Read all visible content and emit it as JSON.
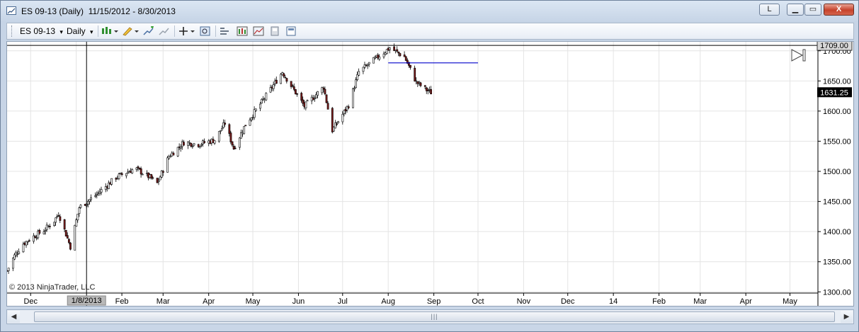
{
  "window": {
    "title": "ES 09-13 (Daily)  11/15/2012 - 8/30/2013",
    "buttons": {
      "link": "L",
      "minimize": "▁",
      "maximize": "▭",
      "close": "X"
    }
  },
  "toolbar": {
    "instrument": "ES 09-13",
    "interval": "Daily",
    "dropdown_glyph": "▾",
    "icons": [
      "candlestick-icon",
      "drawing-pencil-icon",
      "add-indicator-icon",
      "strategy-icon",
      "crosshair-icon",
      "zoom-icon",
      "properties-icon",
      "chart-style-icon",
      "trend-icon",
      "save-icon",
      "template-icon"
    ]
  },
  "chart": {
    "copyright": "© 2013 NinjaTrader, LLC",
    "crosshair_label": "1/8/2013",
    "crosshair_price_label": "1709.00",
    "last_price_label": "1631.25",
    "horizontal_line_price": 1680,
    "colors": {
      "up": "#000000",
      "down": "#7a1a1a",
      "line": "#0000cc"
    }
  },
  "chart_data": {
    "type": "candlestick",
    "xlim": [
      "2012-11-15",
      "2014-05-20"
    ],
    "x_tick_labels": [
      "Dec",
      "1/8/2013",
      "Feb",
      "Mar",
      "Apr",
      "May",
      "Jun",
      "Jul",
      "Aug",
      "Sep",
      "Oct",
      "Nov",
      "Dec",
      "14",
      "Feb",
      "Mar",
      "Apr",
      "May"
    ],
    "y_tick_labels": [
      "1300.00",
      "1350.00",
      "1400.00",
      "1450.00",
      "1500.00",
      "1550.00",
      "1600.00",
      "1650.00",
      "1700.00"
    ],
    "ylim": [
      1298,
      1715
    ],
    "grid": true,
    "close_path": [
      [
        "2012-11-15",
        1335
      ],
      [
        "2012-11-20",
        1360
      ],
      [
        "2012-11-26",
        1380
      ],
      [
        "2012-12-03",
        1392
      ],
      [
        "2012-12-10",
        1402
      ],
      [
        "2012-12-17",
        1418
      ],
      [
        "2012-12-20",
        1430
      ],
      [
        "2012-12-28",
        1375
      ],
      [
        "2013-01-03",
        1440
      ],
      [
        "2013-01-15",
        1462
      ],
      [
        "2013-01-28",
        1490
      ],
      [
        "2013-02-10",
        1505
      ],
      [
        "2013-02-20",
        1490
      ],
      [
        "2013-02-25",
        1480
      ],
      [
        "2013-03-05",
        1525
      ],
      [
        "2013-03-15",
        1548
      ],
      [
        "2013-03-25",
        1545
      ],
      [
        "2013-04-05",
        1552
      ],
      [
        "2013-04-12",
        1580
      ],
      [
        "2013-04-18",
        1538
      ],
      [
        "2013-04-26",
        1578
      ],
      [
        "2013-05-10",
        1625
      ],
      [
        "2013-05-21",
        1665
      ],
      [
        "2013-06-05",
        1608
      ],
      [
        "2013-06-18",
        1640
      ],
      [
        "2013-06-24",
        1568
      ],
      [
        "2013-07-05",
        1610
      ],
      [
        "2013-07-12",
        1665
      ],
      [
        "2013-07-25",
        1690
      ],
      [
        "2013-08-02",
        1705
      ],
      [
        "2013-08-12",
        1690
      ],
      [
        "2013-08-20",
        1648
      ],
      [
        "2013-08-27",
        1635
      ],
      [
        "2013-08-30",
        1631
      ]
    ]
  }
}
